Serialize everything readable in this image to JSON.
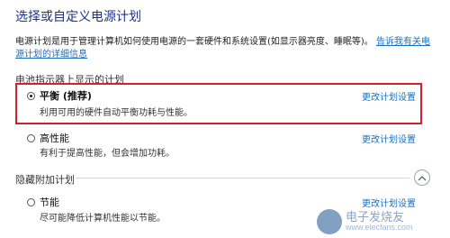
{
  "page": {
    "title": "选择或自定义电源计划",
    "description": "电源计划是用于管理计算机如何使用电源的一套硬件和系统设置(如显示器亮度、睡眠等)。",
    "description_link": "告诉我有关电源计划的详细信息"
  },
  "battery_section": {
    "label": "电池指示器上显示的计划"
  },
  "plans": [
    {
      "name": "平衡 (推荐)",
      "description": "利用可用的硬件自动平衡功耗与性能。",
      "change_link": "更改计划设置",
      "selected": true
    },
    {
      "name": "高性能",
      "description": "有利于提高性能，但会增加功耗。",
      "change_link": "更改计划设置",
      "selected": false
    }
  ],
  "hidden_section": {
    "label": "隐藏附加计划",
    "plans": [
      {
        "name": "节能",
        "description": "尽可能降低计算机性能以节能。",
        "change_link": "更改计划设置",
        "selected": false
      }
    ]
  },
  "watermark": {
    "text": "电子发烧友",
    "sub": "www.elecfans.com"
  },
  "colors": {
    "title": "#1e3287",
    "link": "#1a6fbf",
    "highlight_border": "#d3202a"
  }
}
